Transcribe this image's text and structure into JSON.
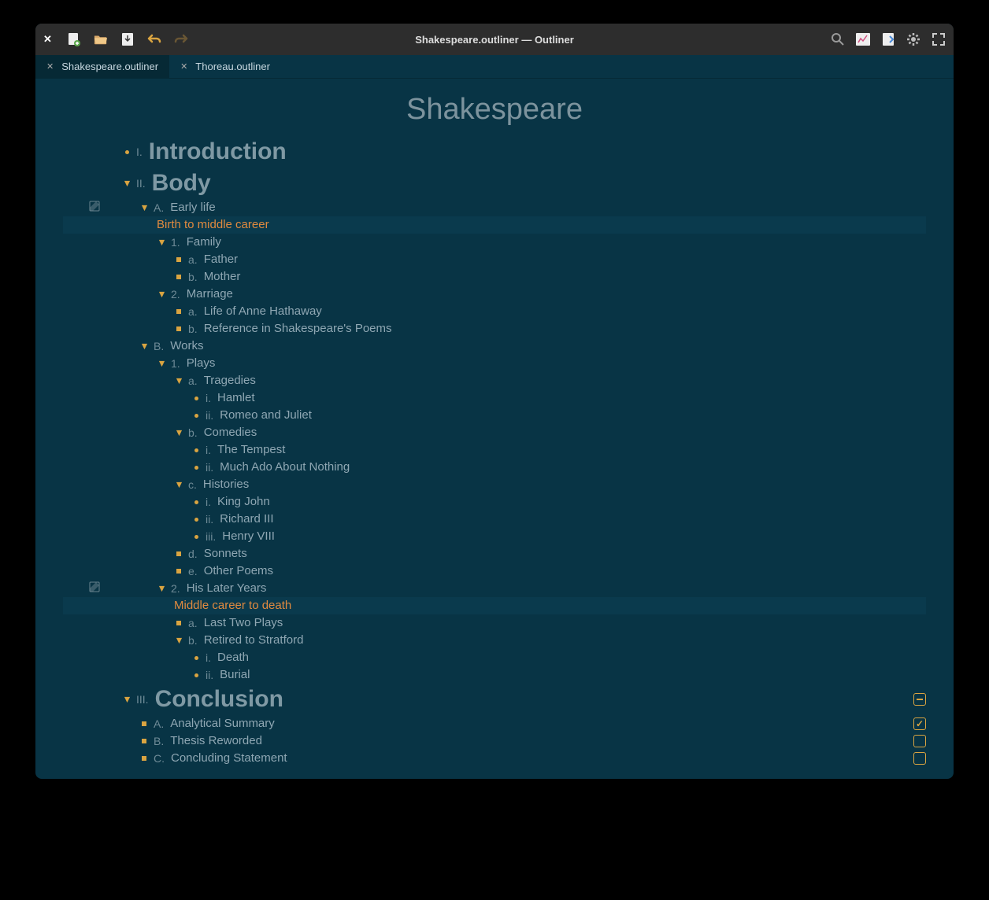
{
  "window_title": "Shakespeare.outliner — Outliner",
  "tabs": [
    {
      "label": "Shakespeare.outliner",
      "active": true
    },
    {
      "label": "Thoreau.outliner",
      "active": false
    }
  ],
  "doc_title": "Shakespeare",
  "icons": {
    "close": "✕",
    "new_doc": "new-document-icon",
    "open": "folder-open-icon",
    "import": "import-icon",
    "undo": "undo-icon",
    "redo": "redo-icon",
    "search": "search-icon",
    "stats": "stats-icon",
    "export": "export-icon",
    "settings": "gear-icon",
    "fullscreen": "fullscreen-icon",
    "note": "note-icon"
  },
  "outline": [
    {
      "lv": 0,
      "marker": "dot",
      "num": "I.",
      "text": "Introduction",
      "heading": true
    },
    {
      "lv": 0,
      "marker": "triangle",
      "num": "II.",
      "text": "Body",
      "heading": true
    },
    {
      "lv": 1,
      "marker": "triangle",
      "num": "A.",
      "text": "Early life",
      "gutter": "note"
    },
    {
      "lv": "1-note",
      "note": true,
      "text": "Birth to middle career"
    },
    {
      "lv": 2,
      "marker": "triangle",
      "num": "1.",
      "text": "Family"
    },
    {
      "lv": 3,
      "marker": "square",
      "num": "a.",
      "text": "Father"
    },
    {
      "lv": 3,
      "marker": "square",
      "num": "b.",
      "text": "Mother"
    },
    {
      "lv": 2,
      "marker": "triangle",
      "num": "2.",
      "text": "Marriage"
    },
    {
      "lv": 3,
      "marker": "square",
      "num": "a.",
      "text": "Life of Anne Hathaway"
    },
    {
      "lv": 3,
      "marker": "square",
      "num": "b.",
      "text": "Reference in Shakespeare's Poems"
    },
    {
      "lv": 1,
      "marker": "triangle",
      "num": "B.",
      "text": "Works"
    },
    {
      "lv": 2,
      "marker": "triangle",
      "num": "1.",
      "text": "Plays"
    },
    {
      "lv": 3,
      "marker": "triangle",
      "num": "a.",
      "text": "Tragedies"
    },
    {
      "lv": 4,
      "marker": "dot",
      "num": "i.",
      "text": "Hamlet"
    },
    {
      "lv": 4,
      "marker": "dot",
      "num": "ii.",
      "text": "Romeo and Juliet"
    },
    {
      "lv": 3,
      "marker": "triangle",
      "num": "b.",
      "text": "Comedies"
    },
    {
      "lv": 4,
      "marker": "dot",
      "num": "i.",
      "text": "The Tempest"
    },
    {
      "lv": 4,
      "marker": "dot",
      "num": "ii.",
      "text": "Much Ado About Nothing"
    },
    {
      "lv": 3,
      "marker": "triangle",
      "num": "c.",
      "text": "Histories"
    },
    {
      "lv": 4,
      "marker": "dot",
      "num": "i.",
      "text": "King John"
    },
    {
      "lv": 4,
      "marker": "dot",
      "num": "ii.",
      "text": "Richard III"
    },
    {
      "lv": 4,
      "marker": "dot",
      "num": "iii.",
      "text": "Henry VIII"
    },
    {
      "lv": 3,
      "marker": "square",
      "num": "d.",
      "text": "Sonnets"
    },
    {
      "lv": 3,
      "marker": "square",
      "num": "e.",
      "text": "Other Poems"
    },
    {
      "lv": 2,
      "marker": "triangle",
      "num": "2.",
      "text": "His Later Years",
      "gutter": "note"
    },
    {
      "lv": "2-note",
      "note": true,
      "text": "Middle career to death"
    },
    {
      "lv": 3,
      "marker": "square",
      "num": "a.",
      "text": "Last Two Plays"
    },
    {
      "lv": 3,
      "marker": "triangle",
      "num": "b.",
      "text": "Retired to Stratford"
    },
    {
      "lv": 4,
      "marker": "dot",
      "num": "i.",
      "text": "Death"
    },
    {
      "lv": 4,
      "marker": "dot",
      "num": "ii.",
      "text": "Burial"
    },
    {
      "lv": 0,
      "marker": "triangle",
      "num": "III.",
      "text": "Conclusion",
      "heading": true,
      "checkbox": "indet"
    },
    {
      "lv": 1,
      "marker": "square",
      "num": "A.",
      "text": "Analytical Summary",
      "checkbox": "checked"
    },
    {
      "lv": 1,
      "marker": "square",
      "num": "B.",
      "text": "Thesis Reworded",
      "checkbox": "empty"
    },
    {
      "lv": 1,
      "marker": "square",
      "num": "C.",
      "text": "Concluding Statement",
      "checkbox": "empty"
    }
  ]
}
